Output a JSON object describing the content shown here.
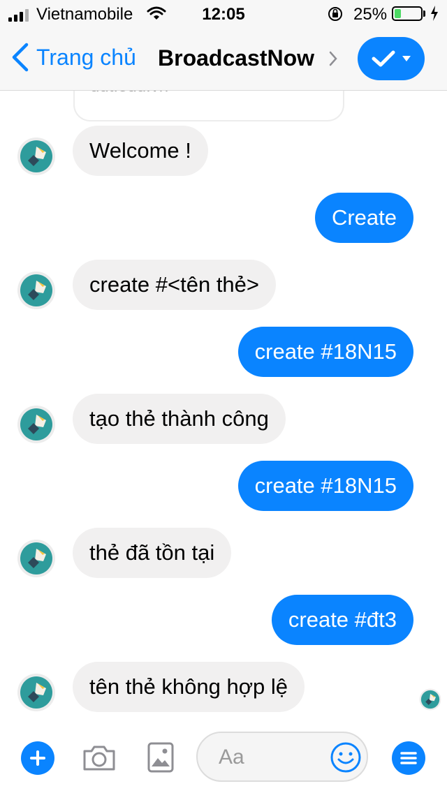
{
  "status_bar": {
    "carrier": "Vietnamobile",
    "time": "12:05",
    "battery_percent": "25%",
    "battery_level": 0.25,
    "icons": [
      "signal-icon",
      "wifi-icon",
      "orientation-lock-icon",
      "battery-icon",
      "charging-icon"
    ]
  },
  "nav": {
    "back_label": "Trang chủ",
    "title": "BroadcastNow",
    "accent": "#0a84ff"
  },
  "conversation": {
    "link_preview_domain": "dut.edu.vn",
    "messages": [
      {
        "from": "bot",
        "text": "Welcome !"
      },
      {
        "from": "user",
        "text": "Create"
      },
      {
        "from": "bot",
        "text": "create #<tên thẻ>"
      },
      {
        "from": "user",
        "text": "create #18N15"
      },
      {
        "from": "bot",
        "text": "tạo thẻ thành công"
      },
      {
        "from": "user",
        "text": "create #18N15"
      },
      {
        "from": "bot",
        "text": "thẻ đã tồn tại"
      },
      {
        "from": "user",
        "text": "create #đt3"
      },
      {
        "from": "bot",
        "text": "tên thẻ không hợp lệ"
      }
    ],
    "colors": {
      "incoming_bubble": "#f1f0f0",
      "outgoing_bubble": "#0a84ff"
    }
  },
  "composer": {
    "placeholder": "Aa",
    "icons": [
      "plus-icon",
      "camera-icon",
      "photo-icon",
      "emoji-icon",
      "menu-icon"
    ]
  }
}
